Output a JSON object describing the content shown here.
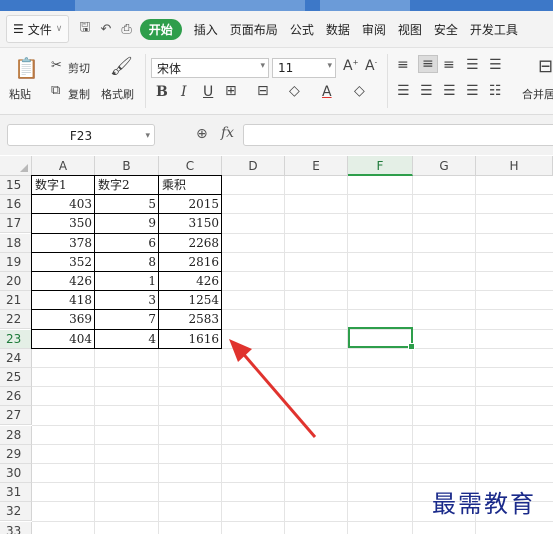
{
  "menubar": {
    "file_label": "文件",
    "items": [
      "开始",
      "插入",
      "页面布局",
      "公式",
      "数据",
      "审阅",
      "视图",
      "安全",
      "开发工具"
    ],
    "active": "开始"
  },
  "ribbon": {
    "paste_label": "粘贴",
    "cut_label": "剪切",
    "copy_label": "复制",
    "format_painter_label": "格式刷",
    "font_name": "宋体",
    "font_size": "11",
    "merge_label": "合并居"
  },
  "formula_bar": {
    "name_box": "F23",
    "fx_label": "fx",
    "formula_value": ""
  },
  "sheet": {
    "columns": [
      "A",
      "B",
      "C",
      "D",
      "E",
      "F",
      "G",
      "H"
    ],
    "selected_column": "F",
    "selected_row": "23",
    "rows": [
      "15",
      "16",
      "17",
      "18",
      "19",
      "20",
      "21",
      "22",
      "23",
      "24",
      "25",
      "26",
      "27",
      "28",
      "29",
      "30",
      "31",
      "32",
      "33"
    ],
    "headers": [
      "数字1",
      "数字2",
      "乘积"
    ],
    "data": [
      [
        403,
        5,
        2015
      ],
      [
        350,
        9,
        3150
      ],
      [
        378,
        6,
        2268
      ],
      [
        352,
        8,
        2816
      ],
      [
        426,
        1,
        426
      ],
      [
        418,
        3,
        1254
      ],
      [
        369,
        7,
        2583
      ],
      [
        404,
        4,
        1616
      ]
    ]
  },
  "watermark": "最需教育",
  "colors": {
    "accent": "#2e9e4b",
    "arrow": "#e0332e",
    "watermark": "#1a2a8a"
  }
}
